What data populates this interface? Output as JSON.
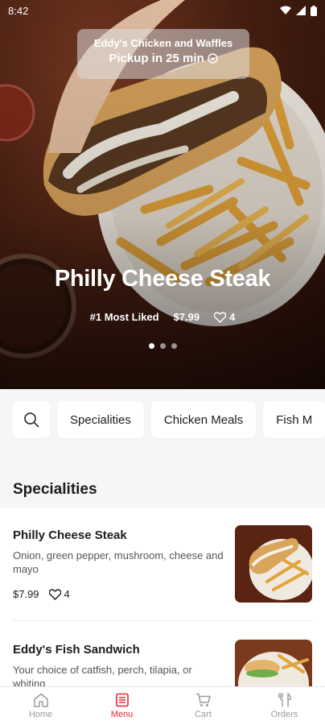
{
  "status_bar": {
    "time": "8:42"
  },
  "hero": {
    "restaurant_name": "Eddy's Chicken and Waffles",
    "pickup_text": "Pickup in 25 min",
    "title": "Philly Cheese Steak",
    "badge": "#1 Most Liked",
    "price": "$7.99",
    "likes": "4",
    "carousel": {
      "count": 3,
      "active": 1
    }
  },
  "categories": {
    "search_icon": "search-icon",
    "items": [
      {
        "label": "Specialities"
      },
      {
        "label": "Chicken Meals"
      },
      {
        "label": "Fish M"
      }
    ]
  },
  "section": {
    "title": "Specialities"
  },
  "menu_items": [
    {
      "name": "Philly Cheese Steak",
      "description": "Onion, green pepper, mushroom, cheese and mayo",
      "price": "$7.99",
      "likes": "4"
    },
    {
      "name": "Eddy's Fish Sandwich",
      "description": "Your choice of catfish, perch, tilapia, or whiting",
      "price": "",
      "likes": ""
    }
  ],
  "bottom_nav": [
    {
      "label": "Home",
      "icon": "home-icon"
    },
    {
      "label": "Menu",
      "icon": "menu-icon",
      "active": true
    },
    {
      "label": "Cart",
      "icon": "cart-icon"
    },
    {
      "label": "Orders",
      "icon": "orders-icon"
    }
  ],
  "colors": {
    "accent": "#e0282e",
    "hero_bg": "#4a2012"
  }
}
